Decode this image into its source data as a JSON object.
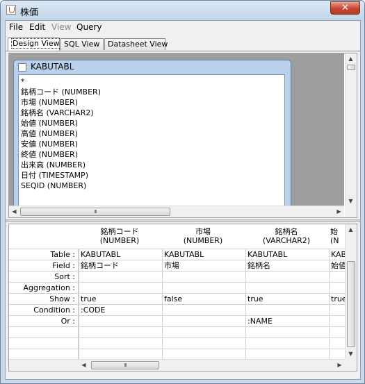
{
  "window": {
    "title": "株価",
    "close_glyph": "✕"
  },
  "menu": {
    "items": [
      {
        "label": "File",
        "enabled": true
      },
      {
        "label": "Edit",
        "enabled": true
      },
      {
        "label": "View",
        "enabled": false
      },
      {
        "label": "Query",
        "enabled": true
      }
    ]
  },
  "tabs": [
    {
      "label": "Design View",
      "active": true
    },
    {
      "label": "SQL View",
      "active": false
    },
    {
      "label": "Datasheet View",
      "active": false
    }
  ],
  "table_window": {
    "title": "KABUTABL",
    "fields": [
      "*",
      "銘柄コード (NUMBER)",
      "市場 (NUMBER)",
      "銘柄名 (VARCHAR2)",
      "始値 (NUMBER)",
      "高値 (NUMBER)",
      "安値 (NUMBER)",
      "終値 (NUMBER)",
      "出来高 (NUMBER)",
      "日付 (TIMESTAMP)",
      "SEQID (NUMBER)"
    ]
  },
  "scroll": {
    "thumb_glyph": "III",
    "up": "▲",
    "down": "▼",
    "left": "◀",
    "right": "▶"
  },
  "grid": {
    "row_labels": [
      "Table :",
      "Field :",
      "Sort :",
      "Aggregation :",
      "Show :",
      "Condition :",
      "Or :"
    ],
    "columns": [
      {
        "header_line1": "銘柄コード",
        "header_line2": "(NUMBER)",
        "cells": [
          "KABUTABL",
          "銘柄コード",
          "",
          "",
          "true",
          ":CODE",
          ""
        ]
      },
      {
        "header_line1": "市場",
        "header_line2": "(NUMBER)",
        "cells": [
          "KABUTABL",
          "市場",
          "",
          "",
          "false",
          "",
          ""
        ]
      },
      {
        "header_line1": "銘柄名",
        "header_line2": "(VARCHAR2)",
        "cells": [
          "KABUTABL",
          "銘柄名",
          "",
          "",
          "true",
          "",
          ":NAME"
        ]
      },
      {
        "header_line1": "始",
        "header_line2": "(N",
        "cells": [
          "KAB",
          "始値",
          "",
          "",
          "true",
          "",
          ""
        ]
      }
    ]
  }
}
